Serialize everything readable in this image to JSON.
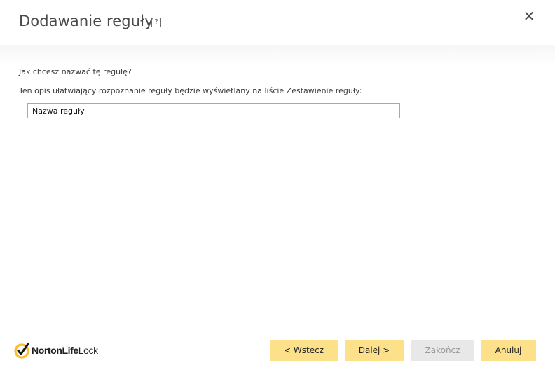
{
  "dialog": {
    "title": "Dodawanie reguły",
    "help_glyph": "?",
    "close_glyph": "✕"
  },
  "form": {
    "question_label": "Jak chcesz nazwać tę regułę?",
    "description_label": "Ten opis ułatwiający rozpoznanie reguły będzie wyświetlany na liście Zestawienie reguły:",
    "rule_name_value": "Nazwa reguły"
  },
  "footer": {
    "logo": {
      "brand_bold": "NortonLife",
      "brand_regular": "Lock",
      "icon": "norton-checkmark-icon",
      "colors": {
        "ring": "#fdbb30",
        "check": "#1a1a1a"
      }
    },
    "buttons": {
      "back_label": "< Wstecz",
      "next_label": "Dalej >",
      "finish_label": "Zakończ",
      "cancel_label": "Anuluj"
    }
  },
  "colors": {
    "button_accent": "#fde08a",
    "button_disabled": "#e8e8e8",
    "title_text": "#4a4a4a"
  }
}
